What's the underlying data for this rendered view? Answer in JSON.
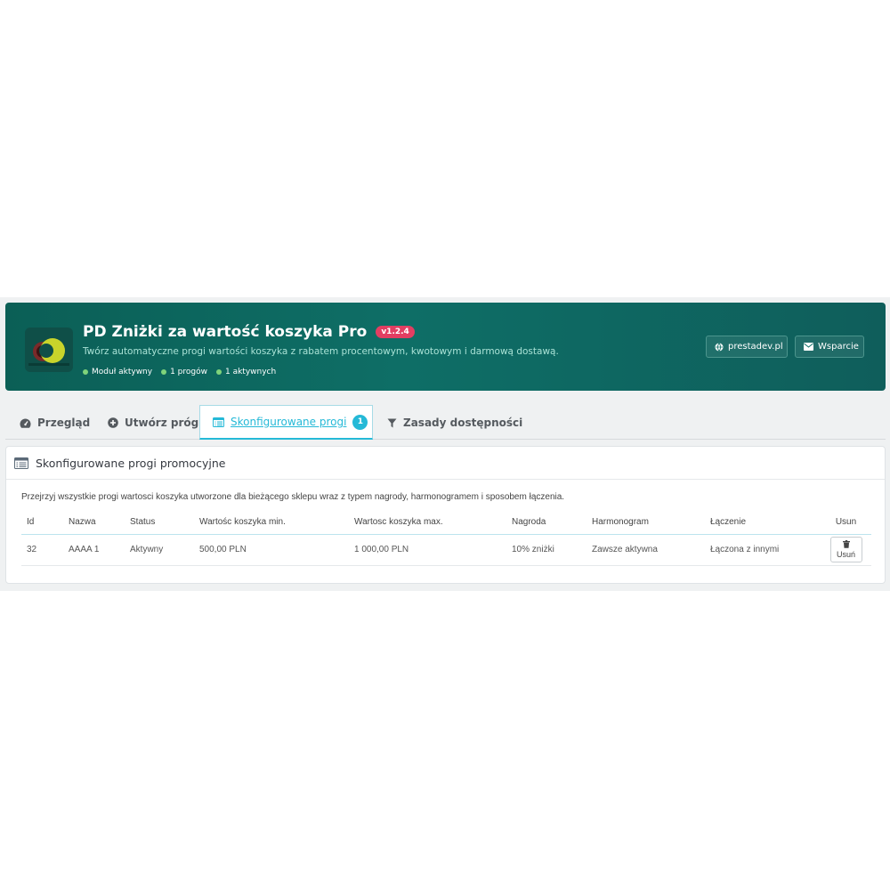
{
  "header": {
    "title": "PD Zniżki za wartość koszyka Pro",
    "version": "v1.2.4",
    "subtitle": "Twórz automatyczne progi wartości koszyka z rabatem procentowym, kwotowym i darmową dostawą.",
    "stats": [
      "Moduł aktywny",
      "1 progów",
      "1 aktywnych"
    ],
    "site_button": "prestadev.pl",
    "support_button": "Wsparcie",
    "colors": {
      "banner": "#0e6e66",
      "badge": "#e23e62",
      "status_dot": "#7fd37b"
    }
  },
  "tabs": [
    {
      "label": "Przegląd",
      "icon": "dashboard-icon"
    },
    {
      "label": "Utwórz próg",
      "icon": "plus-circle-icon"
    },
    {
      "label": "Skonfigurowane progi",
      "icon": "list-icon",
      "count": "1",
      "active": true
    },
    {
      "label": "Zasady dostępności",
      "icon": "filter-icon"
    }
  ],
  "panel": {
    "title": "Skonfigurowane progi promocyjne",
    "description": "Przejrzyj wszystkie progi wartosci koszyka utworzone dla bieżącego sklepu wraz z typem nagrody, harmonogramem i sposobem łączenia.",
    "columns": [
      "Id",
      "Nazwa",
      "Status",
      "Wartośc koszyka min.",
      "Wartosc koszyka max.",
      "Nagroda",
      "Harmonogram",
      "Łączenie",
      "Usun"
    ],
    "rows": [
      {
        "id": "32",
        "name": "AAAA 1",
        "status": "Aktywny",
        "min": "500,00 PLN",
        "max": "1 000,00 PLN",
        "reward": "10% zniżki",
        "schedule": "Zawsze aktywna",
        "combine": "Łączona z innymi",
        "remove_label": "Usuń"
      }
    ]
  },
  "accent_color": "#25b9d7"
}
